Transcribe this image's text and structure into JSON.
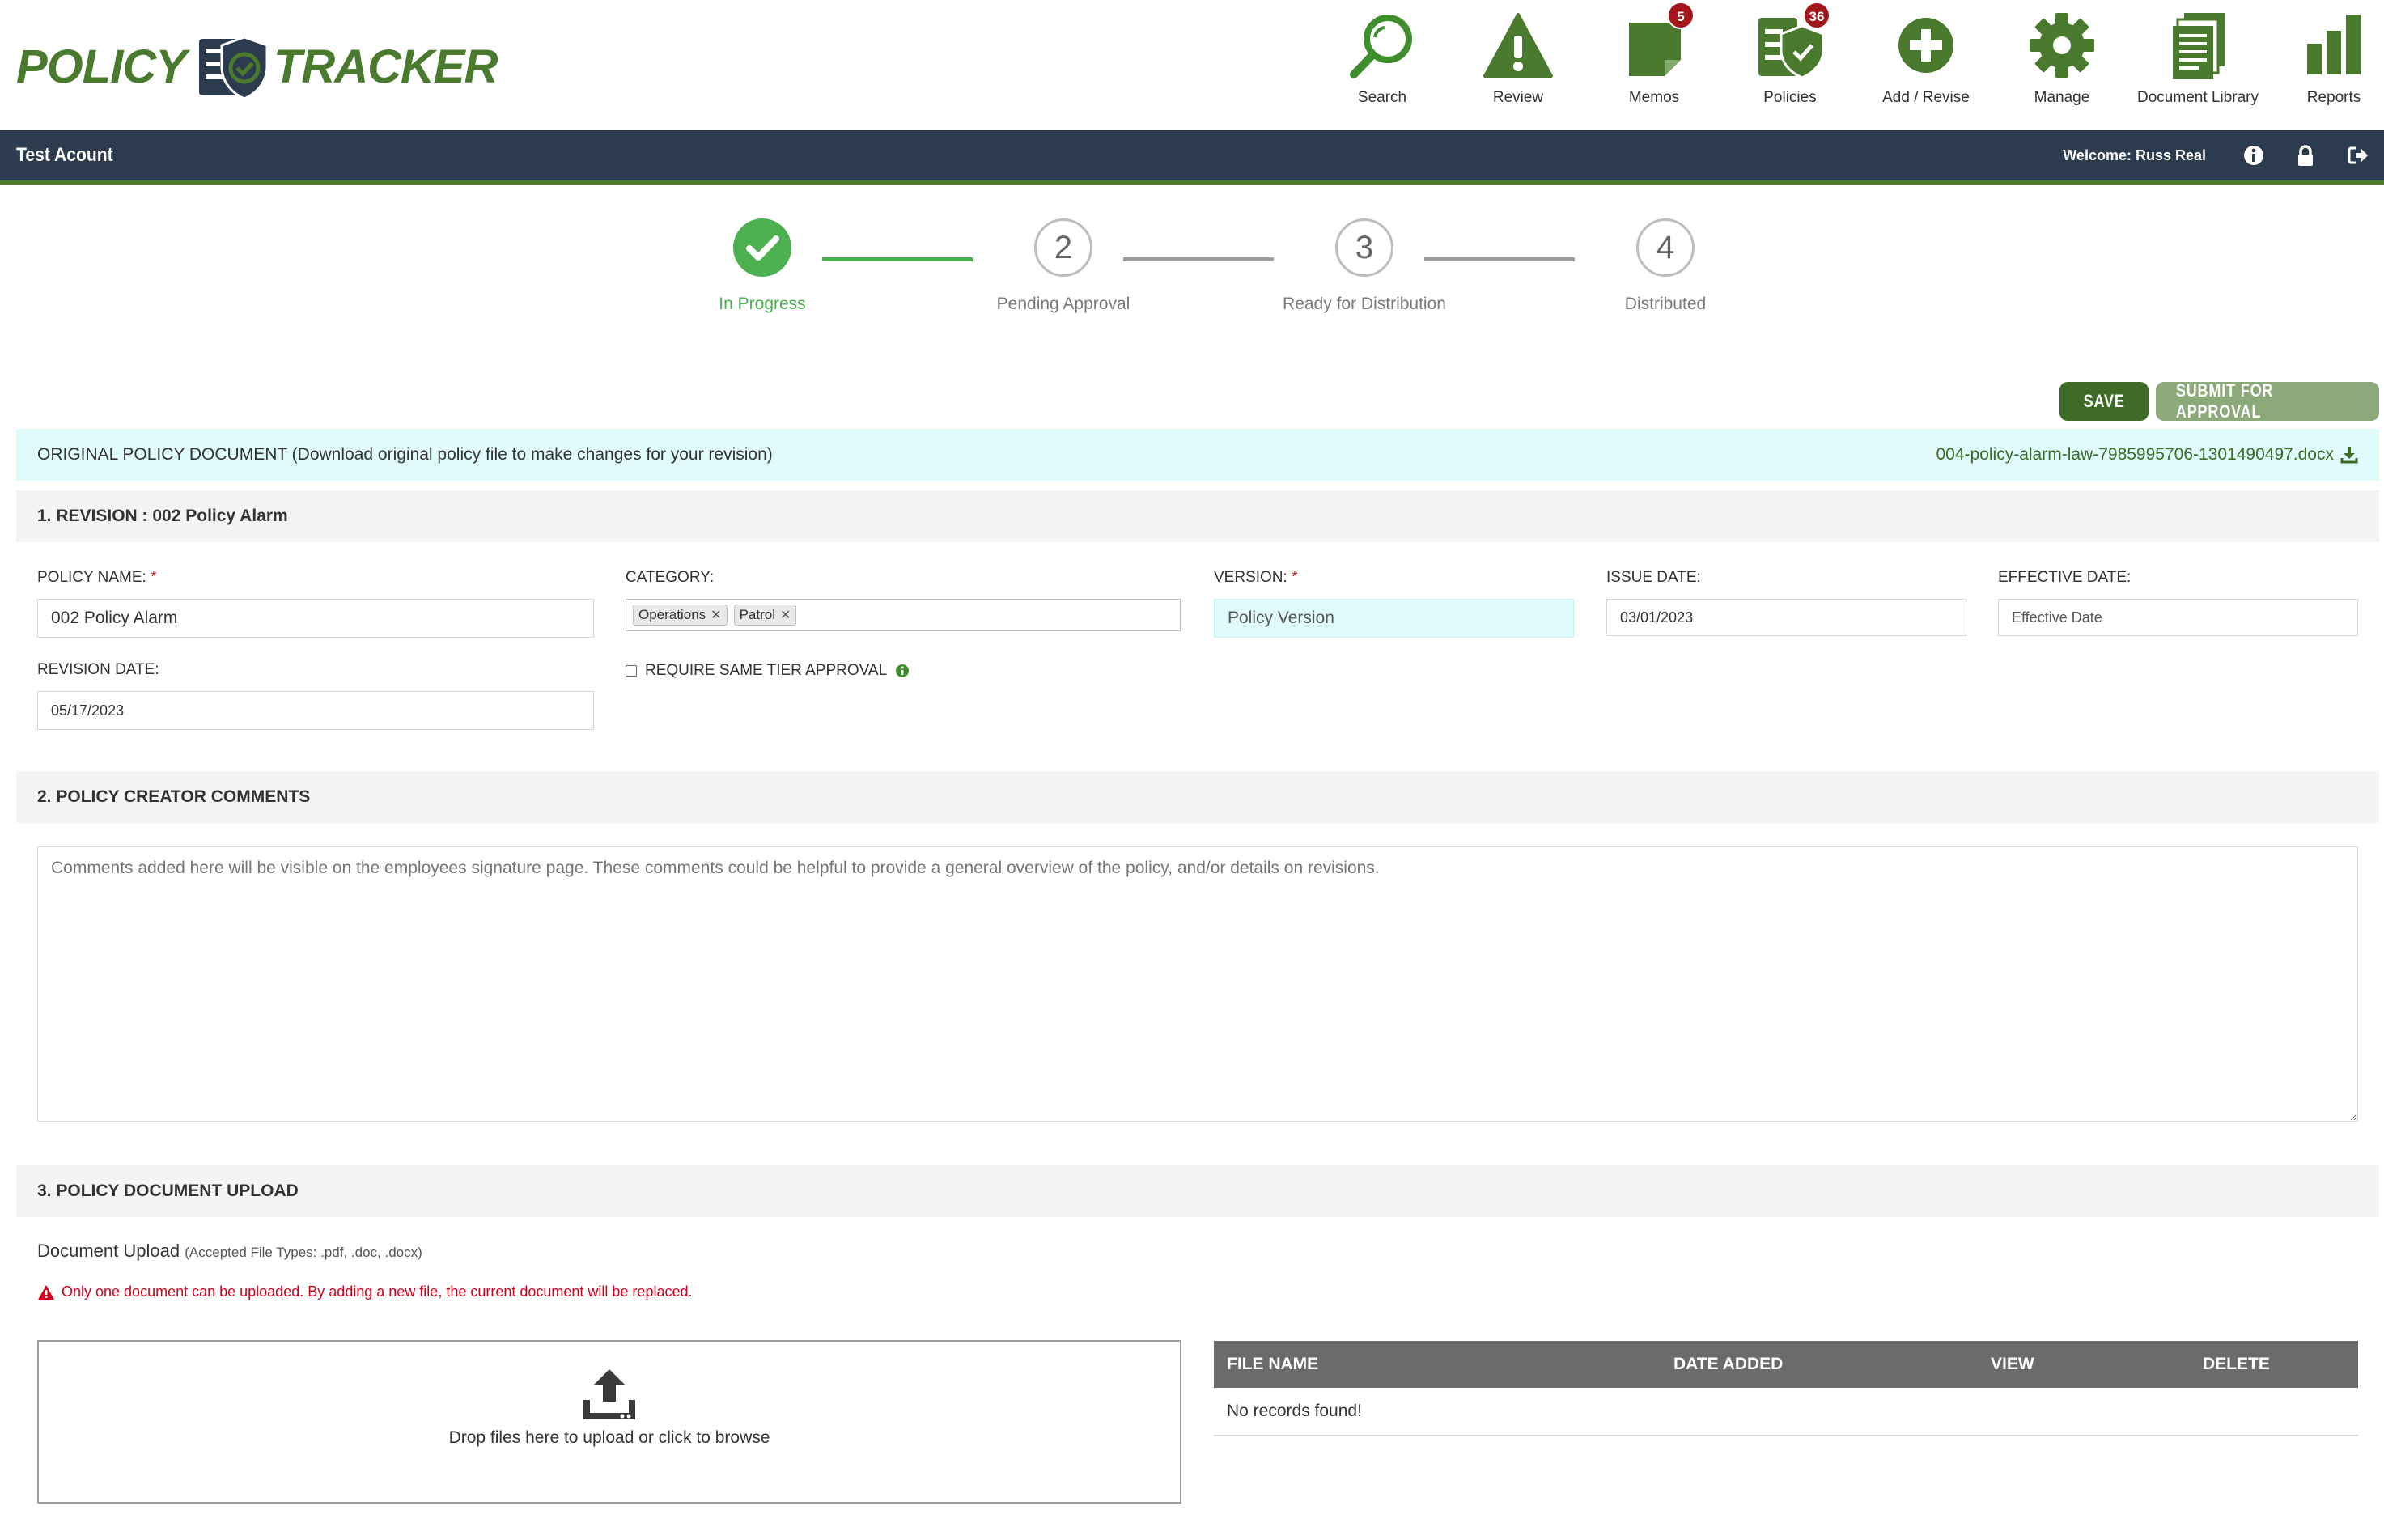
{
  "logo": {
    "word1": "POLICY",
    "word2": "TRACKER"
  },
  "nav": [
    {
      "label": "Search",
      "icon": "search-icon",
      "badge": ""
    },
    {
      "label": "Review",
      "icon": "warning-icon",
      "badge": ""
    },
    {
      "label": "Memos",
      "icon": "memo-icon",
      "badge": "5"
    },
    {
      "label": "Policies",
      "icon": "policies-icon",
      "badge": "36"
    },
    {
      "label": "Add / Revise",
      "icon": "add-circle-icon",
      "badge": ""
    },
    {
      "label": "Manage",
      "icon": "gear-icon",
      "badge": ""
    },
    {
      "label": "Document Library",
      "icon": "document-library-icon",
      "badge": ""
    },
    {
      "label": "Reports",
      "icon": "bar-chart-icon",
      "badge": ""
    }
  ],
  "account_bar": {
    "account": "Test Acount",
    "welcome": "Welcome: Russ Real"
  },
  "stepper": [
    {
      "number": "1",
      "label": "In Progress",
      "state": "done"
    },
    {
      "number": "2",
      "label": "Pending Approval",
      "state": "todo"
    },
    {
      "number": "3",
      "label": "Ready for Distribution",
      "state": "todo"
    },
    {
      "number": "4",
      "label": "Distributed",
      "state": "todo"
    }
  ],
  "actions": {
    "save": "SAVE",
    "submit": "SUBMIT FOR APPROVAL"
  },
  "original_doc": {
    "title": "ORIGINAL POLICY DOCUMENT (Download original policy file to make changes for your revision)",
    "file": "004-policy-alarm-law-7985995706-1301490497.docx"
  },
  "section1": {
    "title": "1. REVISION : 002 Policy Alarm",
    "policy_name_label": "POLICY NAME:",
    "policy_name_value": "002 Policy Alarm",
    "category_label": "CATEGORY:",
    "categories": [
      "Operations",
      "Patrol"
    ],
    "version_label": "VERSION:",
    "version_placeholder": "Policy Version",
    "issue_date_label": "ISSUE DATE:",
    "issue_date_value": "03/01/2023",
    "effective_date_label": "EFFECTIVE DATE:",
    "effective_date_placeholder": "Effective Date",
    "revision_date_label": "REVISION DATE:",
    "revision_date_value": "05/17/2023",
    "same_tier_label": "REQUIRE SAME TIER APPROVAL",
    "required_mark": "*"
  },
  "section2": {
    "title": "2. POLICY CREATOR COMMENTS",
    "comments_placeholder": "Comments added here will be visible on the employees signature page. These comments could be helpful to provide a general overview of the policy, and/or details on revisions."
  },
  "section3": {
    "title": "3. POLICY DOCUMENT UPLOAD",
    "upload_label": "Document Upload",
    "accepted_types": "(Accepted File Types: .pdf, .doc, .docx)",
    "warning": "Only one document can be uploaded. By adding a new file, the current document will be replaced.",
    "dropzone_text": "Drop files here to upload or click to browse",
    "table_headers": [
      "FILE NAME",
      "DATE ADDED",
      "VIEW",
      "DELETE"
    ],
    "empty_text": "No records found!"
  },
  "colors": {
    "brand_green": "#4a7a2e",
    "dark_bar": "#2d3b4e",
    "step_done": "#4caf50",
    "warning_red": "#d0021b",
    "badge_red": "#a3161c"
  }
}
